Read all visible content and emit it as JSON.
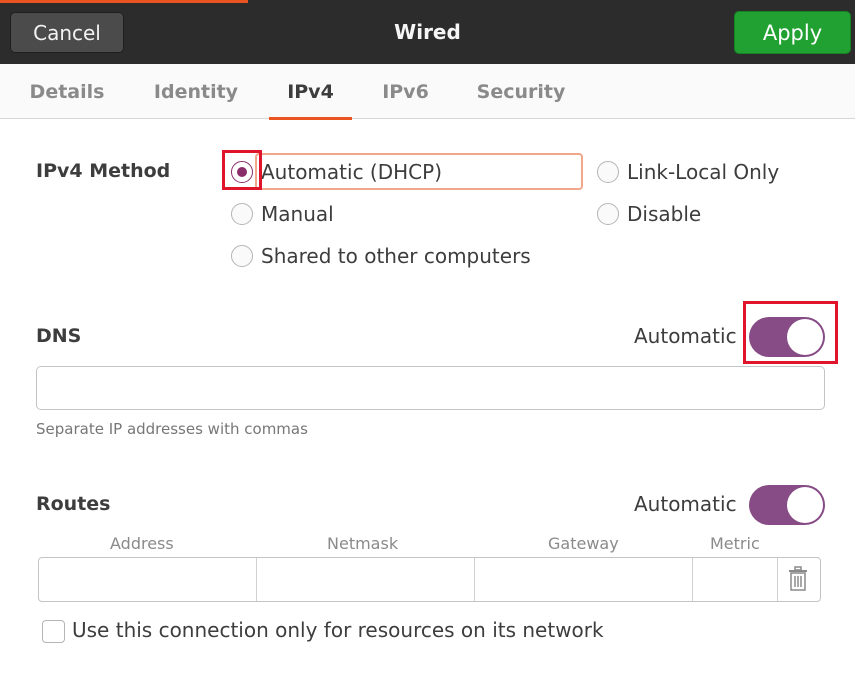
{
  "header": {
    "cancel_label": "Cancel",
    "title": "Wired",
    "apply_label": "Apply",
    "accent_color": "#e95420",
    "apply_color": "#22a133"
  },
  "tabs": [
    {
      "label": "Details",
      "active": false
    },
    {
      "label": "Identity",
      "active": false
    },
    {
      "label": "IPv4",
      "active": true
    },
    {
      "label": "IPv6",
      "active": false
    },
    {
      "label": "Security",
      "active": false
    }
  ],
  "ipv4": {
    "method_label": "IPv4 Method",
    "options": {
      "automatic": {
        "label": "Automatic (DHCP)",
        "selected": true
      },
      "link_local": {
        "label": "Link-Local Only",
        "selected": false
      },
      "manual": {
        "label": "Manual",
        "selected": false
      },
      "disable": {
        "label": "Disable",
        "selected": false
      },
      "shared": {
        "label": "Shared to other computers",
        "selected": false
      }
    }
  },
  "dns": {
    "label": "DNS",
    "automatic_label": "Automatic",
    "automatic_on": true,
    "value": "",
    "hint": "Separate IP addresses with commas"
  },
  "routes": {
    "label": "Routes",
    "automatic_label": "Automatic",
    "automatic_on": true,
    "columns": [
      "Address",
      "Netmask",
      "Gateway",
      "Metric"
    ],
    "row": {
      "address": "",
      "netmask": "",
      "gateway": "",
      "metric": ""
    }
  },
  "restrict_checkbox": {
    "label": "Use this connection only for resources on its network",
    "checked": false
  },
  "colors": {
    "toggle_on": "#874b85",
    "radio_selected": "#8a2e69",
    "highlight_box": "#e0142b"
  }
}
